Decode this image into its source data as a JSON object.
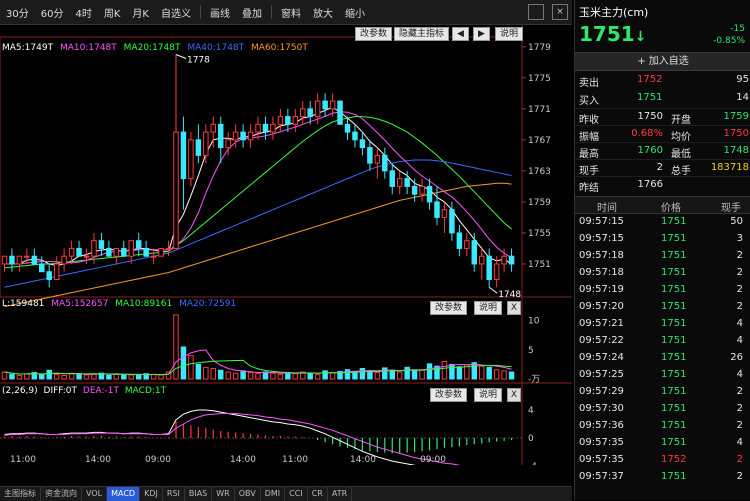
{
  "toolbar": {
    "items": [
      "30分",
      "60分",
      "4时",
      "周K",
      "月K",
      "自选义",
      "画线",
      "叠加",
      "窗料",
      "放大",
      "缩小"
    ],
    "close_label": "×"
  },
  "main_legend": {
    "ma5": "MA5:1749T",
    "ma10": "MA10:1748T",
    "ma20": "MA20:1748T",
    "ma40": "MA40:1748T",
    "ma60": "MA60:1750T"
  },
  "main_buttons": {
    "params": "改参数",
    "hide": "隐藏主指标",
    "left": "◀",
    "right": "▶",
    "help": "说明"
  },
  "price_ticks": [
    "1779",
    "1775",
    "1771",
    "1767",
    "1763",
    "1759",
    "1755",
    "1751"
  ],
  "peak_label": "1778",
  "low_label": "1748",
  "vol_legend": {
    "vol": "L:159481",
    "ma5": "MA5:152657",
    "ma10": "MA10:89161",
    "ma20": "MA20:72591"
  },
  "vol_buttons": {
    "params": "改参数",
    "help": "说明",
    "close": "X"
  },
  "vol_ticks": [
    "10",
    "5",
    "-万"
  ],
  "macd_legend": {
    "name": "(2,26,9)",
    "diff": "DIFF:0T",
    "dea": "DEA:-1T",
    "macd": "MACD:1T"
  },
  "macd_ticks": [
    "4",
    "0",
    "-4"
  ],
  "x_labels": [
    "11:00",
    "14:00",
    "09:00",
    "14:00",
    "11:00",
    "14:00",
    "09:00"
  ],
  "tabs": [
    "主图指标",
    "资金流向",
    "VOL",
    "MACD",
    "KDJ",
    "RSI",
    "BIAS",
    "WR",
    "OBV",
    "DMI",
    "CCI",
    "CR",
    "ATR"
  ],
  "panel": {
    "title": "玉米主力(cm)",
    "price": "1751",
    "arrow": "↓",
    "change": "-15",
    "change_pct": "-0.85%",
    "add_label": "加入自选",
    "sell_label": "卖出",
    "sell_price": "1752",
    "sell_vol": "95",
    "buy_label": "买入",
    "buy_price": "1751",
    "buy_vol": "14",
    "stats": [
      {
        "l1": "昨收",
        "v1": "1750",
        "l2": "开盘",
        "v2": "1759"
      },
      {
        "l1": "振幅",
        "v1": "0.68%",
        "l2": "均价",
        "v2": "1750"
      },
      {
        "l1": "最高",
        "v1": "1760",
        "l2": "最低",
        "v2": "1748"
      },
      {
        "l1": "现手",
        "v1": "2",
        "l2": "总手",
        "v2": "183718"
      },
      {
        "l1": "昨结",
        "v1": "1766",
        "l2": "",
        "v2": ""
      }
    ],
    "trade_head": {
      "time": "时间",
      "price": "价格",
      "vol": "现手"
    },
    "trades": [
      {
        "t": "09:57:15",
        "p": "1751",
        "v": "50",
        "c": "green"
      },
      {
        "t": "09:57:15",
        "p": "1751",
        "v": "3",
        "c": "green"
      },
      {
        "t": "09:57:18",
        "p": "1751",
        "v": "2",
        "c": "green"
      },
      {
        "t": "09:57:18",
        "p": "1751",
        "v": "2",
        "c": "green"
      },
      {
        "t": "09:57:19",
        "p": "1751",
        "v": "2",
        "c": "green"
      },
      {
        "t": "09:57:20",
        "p": "1751",
        "v": "2",
        "c": "green"
      },
      {
        "t": "09:57:21",
        "p": "1751",
        "v": "4",
        "c": "green"
      },
      {
        "t": "09:57:22",
        "p": "1751",
        "v": "4",
        "c": "green"
      },
      {
        "t": "09:57:24",
        "p": "1751",
        "v": "26",
        "c": "green"
      },
      {
        "t": "09:57:25",
        "p": "1751",
        "v": "4",
        "c": "green"
      },
      {
        "t": "09:57:29",
        "p": "1751",
        "v": "2",
        "c": "green"
      },
      {
        "t": "09:57:30",
        "p": "1751",
        "v": "2",
        "c": "green"
      },
      {
        "t": "09:57:36",
        "p": "1751",
        "v": "2",
        "c": "green"
      },
      {
        "t": "09:57:35",
        "p": "1751",
        "v": "4",
        "c": "green"
      },
      {
        "t": "09:57:35",
        "p": "1752",
        "v": "2",
        "c": "red"
      },
      {
        "t": "09:57:37",
        "p": "1751",
        "v": "2",
        "c": "green"
      }
    ]
  },
  "chart_data": {
    "type": "candlestick",
    "y_range": [
      1747,
      1780
    ],
    "candles": [
      [
        1751,
        1752,
        1750,
        1752
      ],
      [
        1752,
        1753,
        1750,
        1751
      ],
      [
        1751,
        1752,
        1750,
        1752
      ],
      [
        1752,
        1753,
        1751,
        1752
      ],
      [
        1752,
        1753,
        1751,
        1751
      ],
      [
        1751,
        1752,
        1750,
        1750
      ],
      [
        1750,
        1751,
        1748,
        1749
      ],
      [
        1749,
        1752,
        1749,
        1751
      ],
      [
        1751,
        1753,
        1750,
        1752
      ],
      [
        1752,
        1754,
        1751,
        1753
      ],
      [
        1753,
        1754,
        1752,
        1752
      ],
      [
        1752,
        1753,
        1751,
        1752
      ],
      [
        1752,
        1755,
        1751,
        1754
      ],
      [
        1754,
        1755,
        1752,
        1753
      ],
      [
        1753,
        1754,
        1752,
        1752
      ],
      [
        1752,
        1753,
        1751,
        1753
      ],
      [
        1753,
        1754,
        1752,
        1752
      ],
      [
        1752,
        1754,
        1751,
        1754
      ],
      [
        1754,
        1755,
        1752,
        1753
      ],
      [
        1753,
        1754,
        1752,
        1752
      ],
      [
        1752,
        1753,
        1751,
        1752
      ],
      [
        1752,
        1753,
        1752,
        1753
      ],
      [
        1753,
        1754,
        1752,
        1753
      ],
      [
        1753,
        1778,
        1753,
        1768
      ],
      [
        1768,
        1770,
        1758,
        1762
      ],
      [
        1762,
        1768,
        1761,
        1767
      ],
      [
        1767,
        1769,
        1764,
        1765
      ],
      [
        1765,
        1769,
        1764,
        1768
      ],
      [
        1768,
        1770,
        1766,
        1769
      ],
      [
        1769,
        1770,
        1764,
        1766
      ],
      [
        1766,
        1768,
        1765,
        1767
      ],
      [
        1767,
        1769,
        1766,
        1768
      ],
      [
        1768,
        1769,
        1766,
        1767
      ],
      [
        1767,
        1769,
        1766,
        1768
      ],
      [
        1768,
        1770,
        1767,
        1769
      ],
      [
        1769,
        1770,
        1767,
        1768
      ],
      [
        1768,
        1770,
        1767,
        1769
      ],
      [
        1769,
        1771,
        1768,
        1770
      ],
      [
        1770,
        1771,
        1768,
        1769
      ],
      [
        1769,
        1771,
        1768,
        1770
      ],
      [
        1770,
        1772,
        1769,
        1771
      ],
      [
        1771,
        1772,
        1769,
        1770
      ],
      [
        1770,
        1773,
        1769,
        1772
      ],
      [
        1772,
        1773,
        1770,
        1771
      ],
      [
        1771,
        1773,
        1770,
        1772
      ],
      [
        1772,
        1772,
        1769,
        1769
      ],
      [
        1769,
        1770,
        1767,
        1768
      ],
      [
        1768,
        1769,
        1766,
        1767
      ],
      [
        1767,
        1768,
        1765,
        1766
      ],
      [
        1766,
        1767,
        1763,
        1764
      ],
      [
        1764,
        1766,
        1762,
        1765
      ],
      [
        1765,
        1766,
        1762,
        1763
      ],
      [
        1763,
        1764,
        1760,
        1761
      ],
      [
        1761,
        1763,
        1760,
        1762
      ],
      [
        1762,
        1763,
        1760,
        1761
      ],
      [
        1761,
        1762,
        1759,
        1760
      ],
      [
        1760,
        1762,
        1759,
        1761
      ],
      [
        1761,
        1762,
        1758,
        1759
      ],
      [
        1759,
        1761,
        1756,
        1757
      ],
      [
        1757,
        1759,
        1755,
        1758
      ],
      [
        1758,
        1759,
        1754,
        1755
      ],
      [
        1755,
        1756,
        1752,
        1753
      ],
      [
        1753,
        1755,
        1752,
        1754
      ],
      [
        1754,
        1755,
        1750,
        1751
      ],
      [
        1751,
        1753,
        1749,
        1752
      ],
      [
        1752,
        1753,
        1748,
        1749
      ],
      [
        1749,
        1752,
        1748,
        1751
      ],
      [
        1751,
        1753,
        1750,
        1752
      ],
      [
        1752,
        1753,
        1750,
        1751
      ]
    ],
    "ma_series": [
      {
        "name": "MA5",
        "values": [
          1751,
          1751,
          1751,
          1751.5,
          1751.6,
          1751.5,
          1751,
          1750.8,
          1751,
          1751.4,
          1752,
          1752.2,
          1752.6,
          1752.8,
          1752.9,
          1752.8,
          1752.6,
          1752.8,
          1753,
          1753,
          1752.8,
          1752.6,
          1752.6,
          1755.8,
          1757.4,
          1759.8,
          1762.4,
          1765.2,
          1767,
          1767.2,
          1767.2,
          1767,
          1767.4,
          1767.4,
          1767.8,
          1768,
          1768.2,
          1768.8,
          1769,
          1769.2,
          1769.8,
          1770,
          1770.4,
          1770.8,
          1771.2,
          1770.6,
          1769.8,
          1769,
          1768,
          1766.8,
          1766,
          1765,
          1763.8,
          1763,
          1762.4,
          1761.4,
          1761,
          1760.6,
          1759.6,
          1759,
          1758,
          1756.6,
          1755.4,
          1754.2,
          1753,
          1751.8,
          1751.4,
          1751.6,
          1751
        ]
      },
      {
        "name": "MA20",
        "values": [
          1750.5,
          1750.6,
          1750.7,
          1750.8,
          1750.9,
          1751,
          1751,
          1751.1,
          1751.2,
          1751.3,
          1751.4,
          1751.5,
          1751.6,
          1751.7,
          1751.8,
          1751.9,
          1752,
          1752.1,
          1752.2,
          1752.3,
          1752.4,
          1752.5,
          1752.6,
          1753.4,
          1754,
          1754.8,
          1755.6,
          1756.4,
          1757.2,
          1758,
          1758.8,
          1759.6,
          1760.4,
          1761.2,
          1762,
          1762.8,
          1763.6,
          1764.4,
          1765.2,
          1766,
          1766.8,
          1767.5,
          1768.2,
          1768.8,
          1769.3,
          1769.6,
          1769.8,
          1770,
          1770,
          1769.9,
          1769.7,
          1769.4,
          1769,
          1768.5,
          1768,
          1767.3,
          1766.6,
          1765.8,
          1765,
          1764.1,
          1763.2,
          1762.3,
          1761.3,
          1760.3,
          1759.3,
          1758.3,
          1757.3,
          1756.3,
          1755.5
        ]
      },
      {
        "name": "MA40",
        "values": [
          1748,
          1748.2,
          1748.4,
          1748.6,
          1748.8,
          1749,
          1749.2,
          1749.4,
          1749.6,
          1749.8,
          1750,
          1750.2,
          1750.4,
          1750.6,
          1750.8,
          1751,
          1751.2,
          1751.4,
          1751.6,
          1751.8,
          1752,
          1752.2,
          1752.4,
          1752.8,
          1753.2,
          1753.6,
          1754,
          1754.4,
          1754.8,
          1755.2,
          1755.6,
          1756,
          1756.4,
          1756.8,
          1757.2,
          1757.6,
          1758,
          1758.4,
          1758.8,
          1759.2,
          1759.6,
          1760,
          1760.4,
          1760.8,
          1761.2,
          1761.6,
          1762,
          1762.4,
          1762.8,
          1763.2,
          1763.5,
          1763.8,
          1764,
          1764.2,
          1764.3,
          1764.4,
          1764.4,
          1764.4,
          1764.3,
          1764.2,
          1764,
          1763.8,
          1763.6,
          1763.4,
          1763.2,
          1763,
          1762.8,
          1762.6,
          1762.4
        ]
      },
      {
        "name": "MA60",
        "values": [
          1745.5,
          1745.7,
          1745.9,
          1746.1,
          1746.3,
          1746.5,
          1746.7,
          1746.9,
          1747.1,
          1747.3,
          1747.5,
          1747.7,
          1747.9,
          1748.1,
          1748.3,
          1748.5,
          1748.7,
          1748.9,
          1749.1,
          1749.3,
          1749.5,
          1749.7,
          1749.9,
          1750.2,
          1750.5,
          1750.8,
          1751.1,
          1751.4,
          1751.7,
          1752,
          1752.3,
          1752.6,
          1752.9,
          1753.2,
          1753.5,
          1753.8,
          1754.1,
          1754.4,
          1754.7,
          1755,
          1755.3,
          1755.6,
          1755.9,
          1756.2,
          1756.5,
          1756.8,
          1757.1,
          1757.4,
          1757.7,
          1758,
          1758.3,
          1758.6,
          1758.9,
          1759.2,
          1759.4,
          1759.6,
          1759.8,
          1760,
          1760.2,
          1760.4,
          1760.6,
          1760.8,
          1761,
          1761.1,
          1761.2,
          1761.3,
          1761.4,
          1761.4,
          1761.3
        ]
      }
    ],
    "volume": [
      1.2,
      0.8,
      0.6,
      0.9,
      1.1,
      0.7,
      1.5,
      0.8,
      0.6,
      1.0,
      0.9,
      0.7,
      0.8,
      1.0,
      0.6,
      0.9,
      0.8,
      0.7,
      0.6,
      0.9,
      0.8,
      0.7,
      1.2,
      11,
      5.5,
      4,
      2.5,
      2,
      1.8,
      1.5,
      1.2,
      1,
      1.4,
      1.1,
      0.9,
      1.2,
      1.0,
      0.8,
      1.1,
      0.9,
      1.2,
      1.0,
      0.8,
      1.4,
      1.1,
      1.3,
      1.6,
      1.2,
      1.8,
      1.4,
      1.1,
      1.9,
      1.5,
      1.2,
      2.0,
      1.4,
      1.6,
      2.6,
      2.2,
      3,
      2.5,
      2.1,
      2.4,
      2.8,
      2.2,
      2.0,
      1.6,
      1.4,
      1.2
    ],
    "macd": [
      0.2,
      0.3,
      0.2,
      0.3,
      0.2,
      0.1,
      0,
      0.1,
      0.2,
      0.3,
      0.2,
      0.2,
      0.3,
      0.3,
      0.2,
      0.2,
      0.1,
      0.2,
      0.2,
      0.1,
      0,
      0,
      0.1,
      2.4,
      2,
      1.8,
      1.6,
      1.4,
      1.2,
      1,
      0.9,
      0.8,
      0.7,
      0.6,
      0.5,
      0.4,
      0.3,
      0.3,
      0.2,
      0.2,
      0.1,
      0,
      -0.3,
      -0.6,
      -0.9,
      -1.2,
      -1.4,
      -1.6,
      -1.8,
      -1.9,
      -2,
      -2.1,
      -2.2,
      -2.2,
      -2.1,
      -2,
      -1.9,
      -1.8,
      -1.6,
      -1.4,
      -1.3,
      -1.2,
      -1,
      -0.9,
      -0.8,
      -0.6,
      -0.5,
      -0.4,
      -0.3
    ],
    "diff": [
      0.5,
      0.6,
      0.6,
      0.7,
      0.7,
      0.6,
      0.5,
      0.5,
      0.6,
      0.7,
      0.7,
      0.7,
      0.8,
      0.8,
      0.7,
      0.7,
      0.6,
      0.7,
      0.7,
      0.6,
      0.5,
      0.5,
      0.6,
      2.6,
      3.4,
      3.8,
      4,
      4,
      3.9,
      3.7,
      3.5,
      3.3,
      3.1,
      2.9,
      2.7,
      2.5,
      2.3,
      2.2,
      2.0,
      1.9,
      1.7,
      1.4,
      1.0,
      0.6,
      0.1,
      -0.4,
      -0.9,
      -1.4,
      -1.9,
      -2.3,
      -2.7,
      -3,
      -3.3,
      -3.5,
      -3.7,
      -3.9,
      -4.0,
      -4.1,
      -4.2,
      -4.2,
      -4.3,
      -4.4,
      -4.5,
      -4.6,
      -4.7,
      -4.8,
      -4.8,
      -4.8,
      -4.8
    ],
    "dea": [
      0.4,
      0.5,
      0.5,
      0.6,
      0.6,
      0.6,
      0.5,
      0.5,
      0.5,
      0.6,
      0.6,
      0.6,
      0.7,
      0.7,
      0.7,
      0.7,
      0.6,
      0.6,
      0.6,
      0.6,
      0.5,
      0.5,
      0.5,
      1.4,
      2.0,
      2.6,
      3.0,
      3.3,
      3.4,
      3.5,
      3.5,
      3.5,
      3.4,
      3.3,
      3.2,
      3.0,
      2.9,
      2.7,
      2.6,
      2.4,
      2.2,
      2.0,
      1.7,
      1.4,
      1.1,
      0.7,
      0.3,
      -0.1,
      -0.5,
      -0.9,
      -1.3,
      -1.6,
      -1.9,
      -2.2,
      -2.5,
      -2.8,
      -3.0,
      -3.2,
      -3.4,
      -3.6,
      -3.7,
      -3.9,
      -4.0,
      -4.2,
      -4.3,
      -4.4,
      -4.5,
      -4.6,
      -4.7
    ]
  }
}
